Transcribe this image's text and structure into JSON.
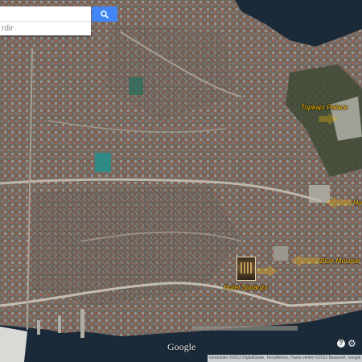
{
  "search": {
    "placeholder": "rdir",
    "button_icon": "search-icon"
  },
  "places": {
    "topkapi": "Topkapı Palace",
    "hagia_sophia": "Ho",
    "blue_mosque": "Blue Mosque",
    "hotel": "Hotel Sultanzir"
  },
  "footer": {
    "logo": "Google",
    "help_icon": "help-icon",
    "help_glyph": "?",
    "settings_icon": "gear-icon",
    "attribution": "Görüntüler ©2013 DigitalGlobe, TerraMetrics, Harita verileri ©2013 Basarsoft, Google   Şartlar   Bir harita hatası bildirin"
  },
  "colors": {
    "label_accent": "#ffc000",
    "search_button": "#4285f4",
    "water": "#1b2a38",
    "land": "#6e6a66"
  }
}
